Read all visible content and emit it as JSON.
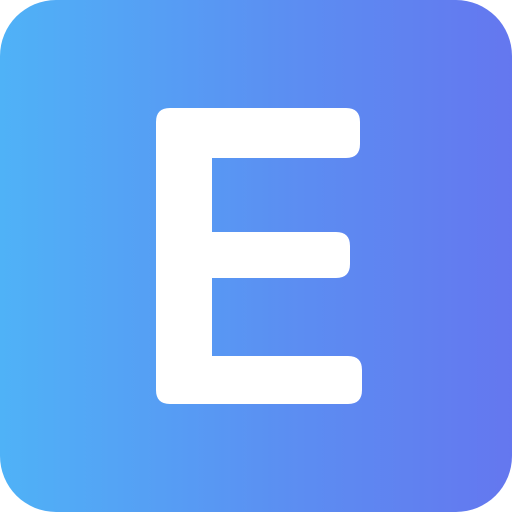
{
  "icon": {
    "letter": "E",
    "gradient_start": "#4fb2f7",
    "gradient_end": "#6477ef",
    "letter_color": "#ffffff",
    "semantic": "letter-e-app-icon"
  }
}
